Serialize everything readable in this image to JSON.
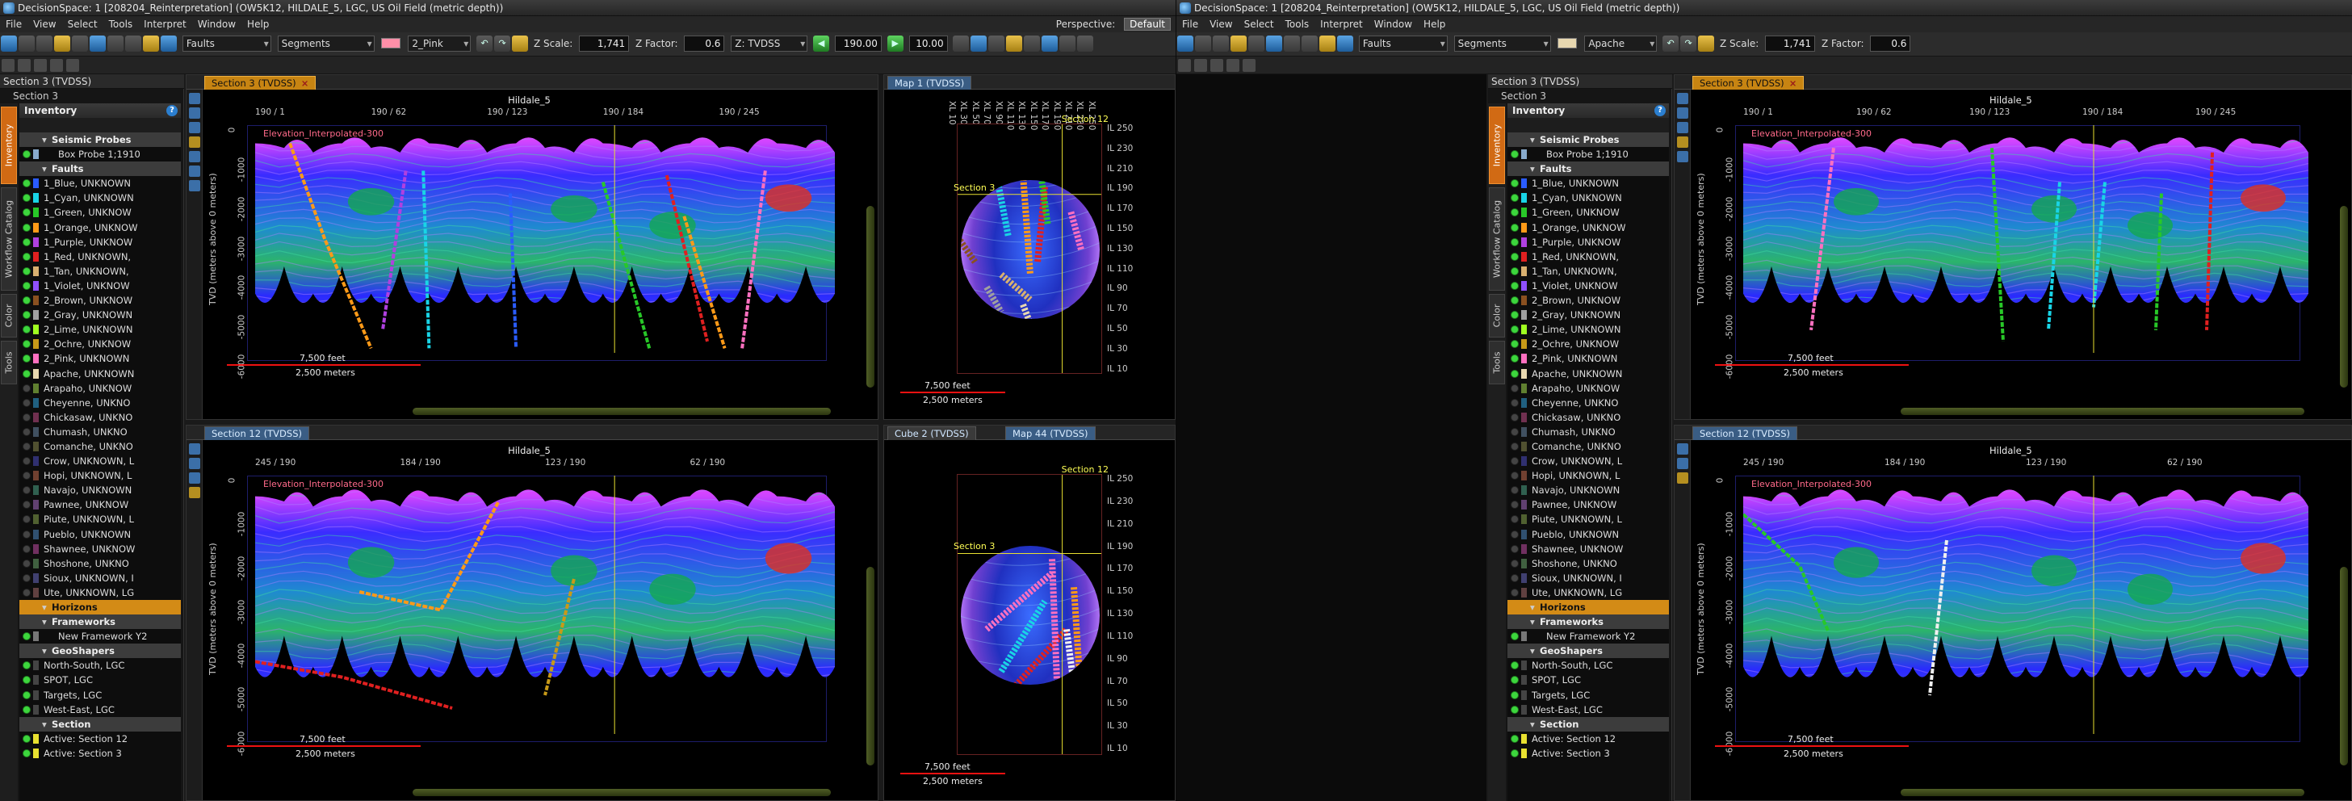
{
  "windows": [
    {
      "title": "DecisionSpace: 1 [208204_Reinterpretation] (OW5K12, HILDALE_5, LGC, US Oil Field (metric depth))",
      "menu": [
        "File",
        "View",
        "Select",
        "Tools",
        "Interpret",
        "Window",
        "Help"
      ],
      "perspective_label": "Perspective:",
      "perspective_value": "Default",
      "toolbar": {
        "faults": "Faults",
        "segments": "Segments",
        "pink": "2_Pink",
        "z_scale_label": "Z Scale:",
        "z_scale": "1,741",
        "z_factor_label": "Z Factor:",
        "z_factor": "0.6",
        "domain": "Z: TVDSS",
        "val1": "190.00",
        "val2": "10.00"
      }
    },
    {
      "title": "DecisionSpace: 1 [208204_Reinterpretation] (OW5K12, HILDALE_5, LGC, US Oil Field (metric depth))",
      "menu": [
        "File",
        "View",
        "Select",
        "Tools",
        "Interpret",
        "Window",
        "Help"
      ],
      "toolbar": {
        "faults": "Faults",
        "segments": "Segments",
        "apache": "Apache",
        "z_scale_label": "Z Scale:",
        "z_scale": "1,741",
        "z_factor_label": "Z Factor:",
        "z_factor": "0.6"
      }
    }
  ],
  "sidebar": {
    "header": "Section 3 (TVDSS)",
    "subheader": "Section 3",
    "vtabs": [
      "Inventory",
      "Workflow Catalog",
      "Color",
      "Tools"
    ],
    "inventory_title": "Inventory",
    "items": [
      {
        "type": "section",
        "label": "Seismic Probes"
      },
      {
        "type": "item",
        "label": "Box Probe 1;1910",
        "color": "#88aacc",
        "indent": true
      },
      {
        "type": "section",
        "label": "Faults"
      },
      {
        "type": "item",
        "label": "1_Blue, UNKNOWN",
        "color": "#2a5cff"
      },
      {
        "type": "item",
        "label": "1_Cyan, UNKNOWN",
        "color": "#19d4e6"
      },
      {
        "type": "item",
        "label": "1_Green, UNKNOW",
        "color": "#28c828"
      },
      {
        "type": "item",
        "label": "1_Orange, UNKNOW",
        "color": "#ff9a18"
      },
      {
        "type": "item",
        "label": "1_Purple, UNKNOW",
        "color": "#b040e0"
      },
      {
        "type": "item",
        "label": "1_Red, UNKNOWN,",
        "color": "#e02020"
      },
      {
        "type": "item",
        "label": "1_Tan, UNKNOWN,",
        "color": "#d8b070"
      },
      {
        "type": "item",
        "label": "1_Violet, UNKNOW",
        "color": "#9050ff"
      },
      {
        "type": "item",
        "label": "2_Brown, UNKNOW",
        "color": "#8a5020"
      },
      {
        "type": "item",
        "label": "2_Gray, UNKNOWN",
        "color": "#a0a0a0"
      },
      {
        "type": "item",
        "label": "2_Lime, UNKNOWN",
        "color": "#a0ff20"
      },
      {
        "type": "item",
        "label": "2_Ochre, UNKNOW",
        "color": "#c89a18"
      },
      {
        "type": "item",
        "label": "2_Pink, UNKNOWN",
        "color": "#ff70c0"
      },
      {
        "type": "item",
        "label": "Apache, UNKNOWN",
        "color": "#e8d8b0"
      },
      {
        "type": "item",
        "label": "Arapaho, UNKNOW",
        "color": "#608030",
        "off": true
      },
      {
        "type": "item",
        "label": "Cheyenne, UNKNO",
        "color": "#206080",
        "off": true
      },
      {
        "type": "item",
        "label": "Chickasaw, UNKNO",
        "color": "#703050",
        "off": true
      },
      {
        "type": "item",
        "label": "Chumash, UNKNO",
        "color": "#405060",
        "off": true
      },
      {
        "type": "item",
        "label": "Comanche, UNKNO",
        "color": "#505030",
        "off": true
      },
      {
        "type": "item",
        "label": "Crow, UNKNOWN, L",
        "color": "#303070",
        "off": true
      },
      {
        "type": "item",
        "label": "Hopi, UNKNOWN, L",
        "color": "#704030",
        "off": true
      },
      {
        "type": "item",
        "label": "Navajo, UNKNOWN",
        "color": "#306050",
        "off": true
      },
      {
        "type": "item",
        "label": "Pawnee, UNKNOW",
        "color": "#604070",
        "off": true
      },
      {
        "type": "item",
        "label": "Piute, UNKNOWN, L",
        "color": "#506030",
        "off": true
      },
      {
        "type": "item",
        "label": "Pueblo, UNKNOWN",
        "color": "#305070",
        "off": true
      },
      {
        "type": "item",
        "label": "Shawnee, UNKNOW",
        "color": "#703060",
        "off": true
      },
      {
        "type": "item",
        "label": "Shoshone, UNKNO",
        "color": "#406040",
        "off": true
      },
      {
        "type": "item",
        "label": "Sioux, UNKNOWN, I",
        "color": "#404070",
        "off": true
      },
      {
        "type": "item",
        "label": "Ute, UNKNOWN, LG",
        "color": "#604040",
        "off": true
      },
      {
        "type": "section",
        "label": "Horizons",
        "highlight": true
      },
      {
        "type": "section",
        "label": "Frameworks"
      },
      {
        "type": "item",
        "label": "New Framework Y2",
        "color": "#777777",
        "indent": true
      },
      {
        "type": "section",
        "label": "GeoShapers"
      },
      {
        "type": "item",
        "label": "North-South, LGC",
        "color": "#444444"
      },
      {
        "type": "item",
        "label": "SPOT, LGC",
        "color": "#444444"
      },
      {
        "type": "item",
        "label": "Targets, LGC",
        "color": "#444444"
      },
      {
        "type": "item",
        "label": "West-East, LGC",
        "color": "#444444"
      },
      {
        "type": "section",
        "label": "Section"
      },
      {
        "type": "item",
        "label": "Active: Section 12",
        "color": "#e8e030"
      },
      {
        "type": "item",
        "label": "Active: Section 3",
        "color": "#e8e030"
      }
    ]
  },
  "panels": {
    "section3": {
      "tab": "Section 3 (TVDSS)",
      "title": "Hildale_5",
      "ticks": [
        "190 / 1",
        "190 / 62",
        "190 / 123",
        "190 / 184",
        "190 / 245"
      ],
      "elev": "Elevation_Interpolated-300",
      "ylabel": "TVD (meters above 0 meters)",
      "yticks": [
        "0",
        "-1000",
        "-2000",
        "-3000",
        "-4000",
        "-5000",
        "-6000"
      ],
      "scale_ft": "7,500 feet",
      "scale_m": "2,500 meters"
    },
    "section12": {
      "tab": "Section 12 (TVDSS)",
      "title": "Hildale_5",
      "ticks": [
        "245 / 190",
        "184 / 190",
        "123 / 190",
        "62 / 190"
      ],
      "elev": "Elevation_Interpolated-300",
      "ylabel": "TVD (meters above 0 meters)",
      "yticks": [
        "0",
        "-1000",
        "-2000",
        "-3000",
        "-4000",
        "-5000",
        "-6000"
      ],
      "scale_ft": "7,500 feet",
      "scale_m": "2,500 meters"
    },
    "map1": {
      "tab": "Map 1 (TVDSS)",
      "xl": [
        "XL 10",
        "XL 30",
        "XL 50",
        "XL 70",
        "XL 90",
        "XL 110",
        "XL 130",
        "XL 150",
        "XL 170",
        "XL 190",
        "XL 210",
        "XL 230",
        "XL 250"
      ],
      "il": [
        "IL 250",
        "IL 230",
        "IL 210",
        "IL 190",
        "IL 170",
        "IL 150",
        "IL 130",
        "IL 110",
        "IL 90",
        "IL 70",
        "IL 50",
        "IL 30",
        "IL 10"
      ],
      "sec12": "Section 12",
      "sec3": "Section 3",
      "scale_ft": "7,500 feet",
      "scale_m": "2,500 meters"
    },
    "map44": {
      "tabs": [
        "Cube 2 (TVDSS)",
        "Map 44 (TVDSS)"
      ],
      "sec12": "Section 12",
      "sec3": "Section 3",
      "scale_ft": "7,500 feet",
      "scale_m": "2,500 meters"
    }
  }
}
